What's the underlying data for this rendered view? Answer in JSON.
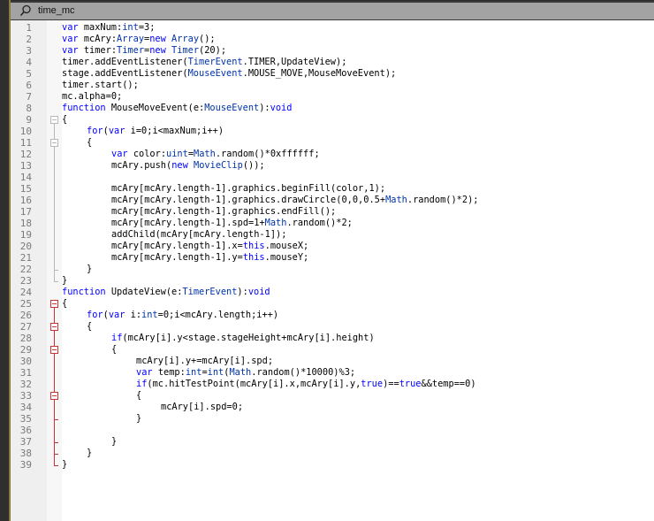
{
  "title_bar": {
    "icon": "search-icon",
    "name": "time_mc"
  },
  "colors": {
    "keyword": "#0000ff",
    "type": "#0033aa",
    "fold_active": "#cc3333",
    "fold_inactive": "#b8b8b8"
  },
  "code_lines": [
    "var maxNum:int=3;",
    "var mcAry:Array=new Array();",
    "var timer:Timer=new Timer(20);",
    "timer.addEventListener(TimerEvent.TIMER,UpdateView);",
    "stage.addEventListener(MouseEvent.MOUSE_MOVE,MouseMoveEvent);",
    "timer.start();",
    "mc.alpha=0;",
    "function MouseMoveEvent(e:MouseEvent):void",
    "{",
    "\tfor(var i=0;i<maxNum;i++)",
    "\t{",
    "\t\tvar color:uint=Math.random()*0xffffff;",
    "\t\tmcAry.push(new MovieClip());",
    "",
    "\t\tmcAry[mcAry.length-1].graphics.beginFill(color,1);",
    "\t\tmcAry[mcAry.length-1].graphics.drawCircle(0,0,0.5+Math.random()*2);",
    "\t\tmcAry[mcAry.length-1].graphics.endFill();",
    "\t\tmcAry[mcAry.length-1].spd=1+Math.random()*2;",
    "\t\taddChild(mcAry[mcAry.length-1]);",
    "\t\tmcAry[mcAry.length-1].x=this.mouseX;",
    "\t\tmcAry[mcAry.length-1].y=this.mouseY;",
    "\t}",
    "}",
    "function UpdateView(e:TimerEvent):void",
    "{",
    "\tfor(var i:int=0;i<mcAry.length;i++)",
    "\t{",
    "\t\tif(mcAry[i].y<stage.stageHeight+mcAry[i].height)",
    "\t\t{",
    "\t\t\tmcAry[i].y+=mcAry[i].spd;",
    "\t\t\tvar temp:int=int(Math.random()*10000)%3;",
    "\t\t\tif(mc.hitTestPoint(mcAry[i].x,mcAry[i].y,true)==true&&temp==0)",
    "\t\t\t{",
    "\t\t\t\tmcAry[i].spd=0;",
    "\t\t\t}",
    "",
    "\t\t}",
    "\t}",
    "}"
  ]
}
